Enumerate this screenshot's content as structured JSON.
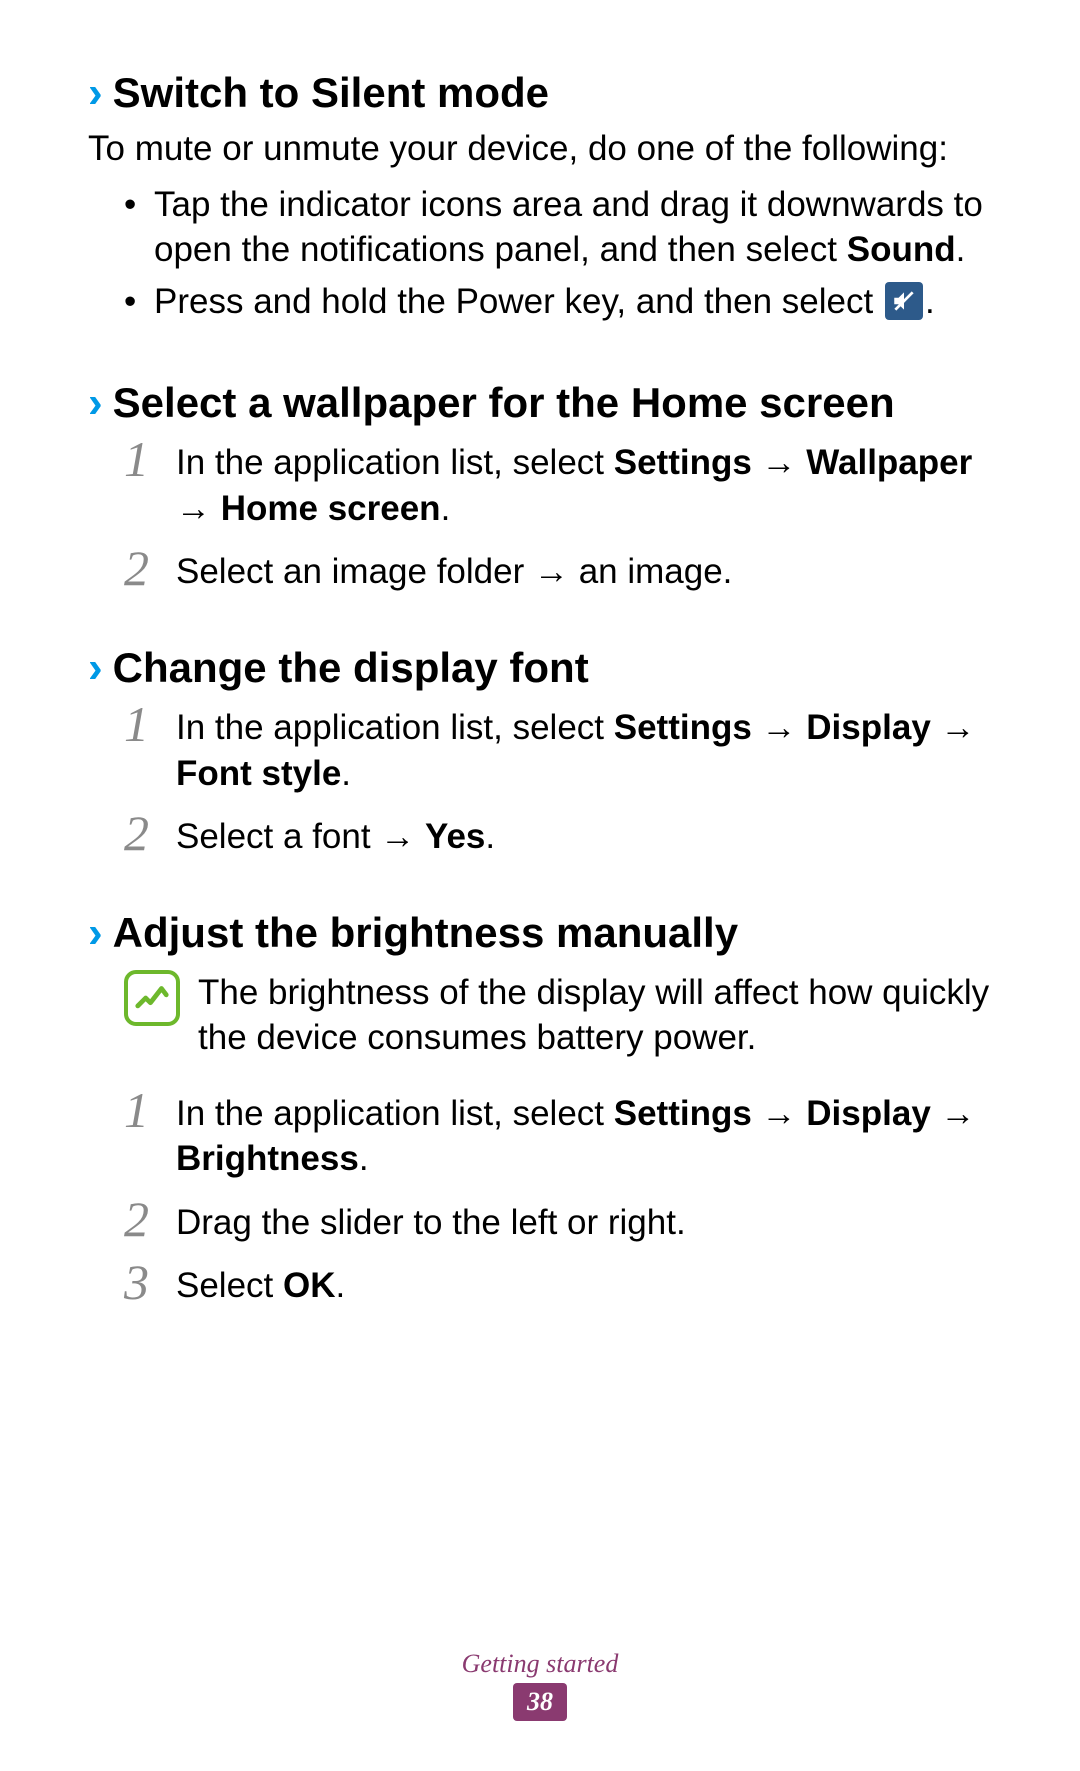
{
  "sections": {
    "silent": {
      "title": "Switch to Silent mode",
      "intro": "To mute or unmute your device, do one of the following:",
      "bullets": {
        "b1a": "Tap the indicator icons area and drag it downwards to open the notifications panel, and then select ",
        "b1b": "Sound",
        "b1c": ".",
        "b2a": "Press and hold the Power key, and then select ",
        "b2b": "."
      }
    },
    "wallpaper": {
      "title": "Select a wallpaper for the Home screen",
      "steps": {
        "s1a": "In the application list, select ",
        "s1b": "Settings",
        "s1arrow1": " → ",
        "s1c": "Wallpaper",
        "s1arrow2": " → ",
        "s1d": "Home screen",
        "s1e": ".",
        "s2a": "Select an image folder → an image."
      }
    },
    "font": {
      "title": "Change the display font",
      "steps": {
        "s1a": "In the application list, select ",
        "s1b": "Settings",
        "s1arrow1": " → ",
        "s1c": "Display",
        "s1arrow2": " → ",
        "s1d": "Font style",
        "s1e": ".",
        "s2a": "Select a font → ",
        "s2b": "Yes",
        "s2c": "."
      }
    },
    "brightness": {
      "title": "Adjust the brightness manually",
      "note": "The brightness of the display will affect how quickly the device consumes battery power.",
      "steps": {
        "s1a": "In the application list, select ",
        "s1b": "Settings",
        "s1arrow1": " → ",
        "s1c": "Display",
        "s1arrow2": " → ",
        "s1d": "Brightness",
        "s1e": ".",
        "s2": "Drag the slider to the left or right.",
        "s3a": "Select ",
        "s3b": "OK",
        "s3c": "."
      }
    }
  },
  "footer": {
    "section": "Getting started",
    "page": "38"
  },
  "numbers": {
    "n1": "1",
    "n2": "2",
    "n3": "3"
  }
}
